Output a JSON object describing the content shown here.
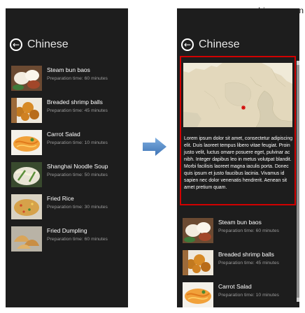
{
  "watermark": "www.bianceng.cn",
  "page_title": "Chinese",
  "left_list": [
    {
      "name": "Steam bun baos",
      "time": "Preparation time: 60 minutes",
      "image": "steamed-buns"
    },
    {
      "name": "Breaded shrimp balls",
      "time": "Preparation time: 45 minutes",
      "image": "shrimp-balls"
    },
    {
      "name": "Carrot Salad",
      "time": "Preparation time: 10 minutes",
      "image": "carrot-salad"
    },
    {
      "name": "Shanghai Noodle Soup",
      "time": "Preparation time: 50 minutes",
      "image": "noodle-soup"
    },
    {
      "name": "Fried Rice",
      "time": "Preparation time: 30 minutes",
      "image": "fried-rice"
    },
    {
      "name": "Fried Dumpling",
      "time": "Preparation time: 60 minutes",
      "image": "dumplings"
    }
  ],
  "right_list": [
    {
      "name": "Steam bun baos",
      "time": "Preparation time: 60 minutes",
      "image": "steamed-buns"
    },
    {
      "name": "Breaded shrimp balls",
      "time": "Preparation time: 45 minutes",
      "image": "shrimp-balls"
    },
    {
      "name": "Carrot Salad",
      "time": "Preparation time: 10 minutes",
      "image": "carrot-salad"
    }
  ],
  "detail": {
    "map_marker": "red asterisk",
    "description": "Lorem ipsum dolor sit amet, consectetur adipiscing elit. Duis laoreet tempus libero vitae feugiat. Proin justo velit, luctus omare posuere eget, pulvinar ac nibh. Integer dapibus leo in metus volutpat blandit. Morbi facilisis laoreet magna iaculis porta. Donec quis ipsum et justo faucibus lacinia. Vivamus id sapien nec dolor venenatis hendrerit. Aenean sit amet pretium quam."
  },
  "colors": {
    "panel_bg": "#1d1d1d",
    "highlight_border": "#d10000",
    "map_land": "#e3d8bc",
    "arrow_blue": "#4f86c6"
  }
}
